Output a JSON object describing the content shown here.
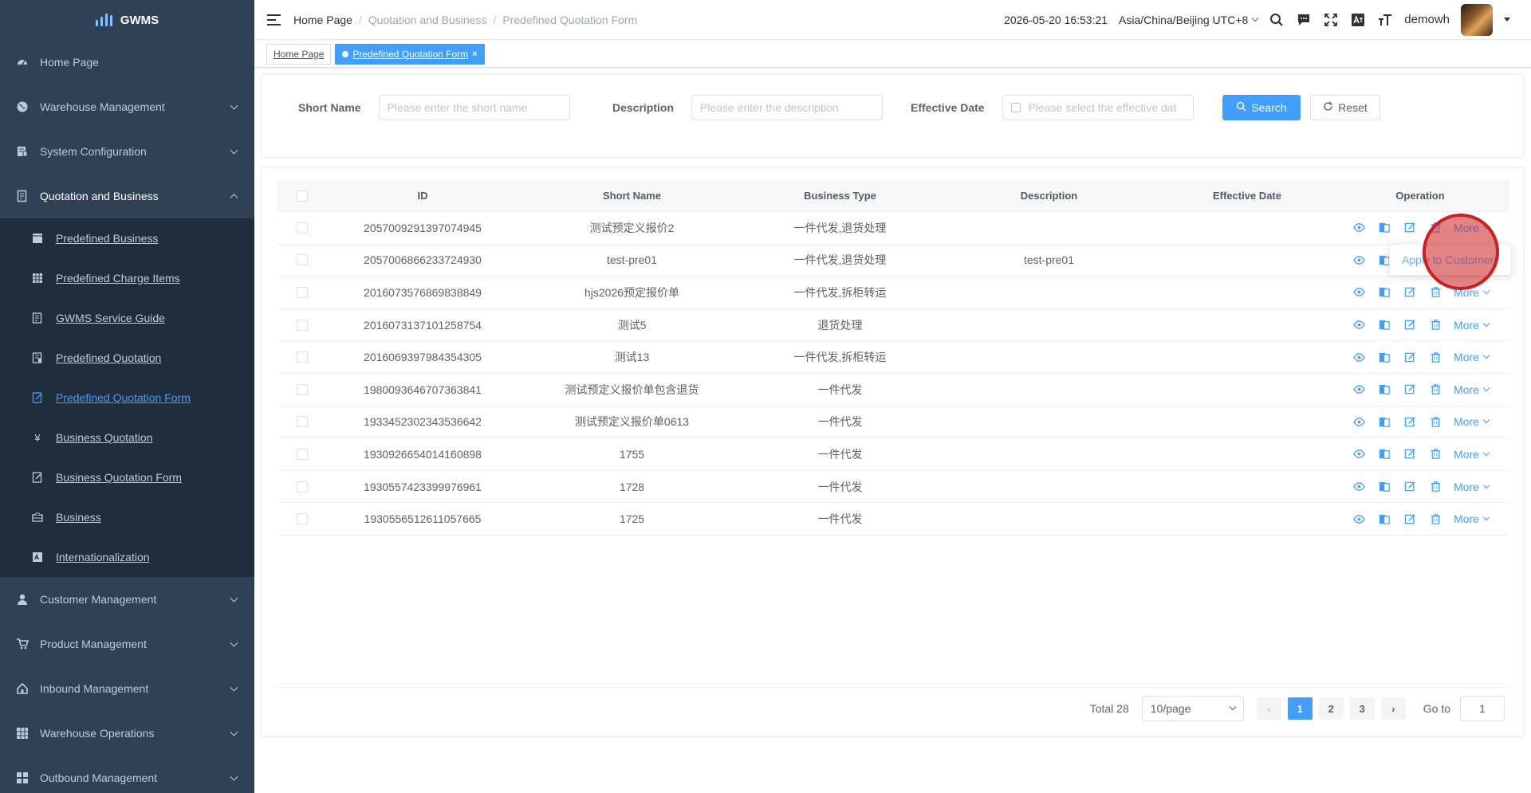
{
  "app": {
    "logo_text": "GWMS"
  },
  "sidebar": {
    "items": [
      {
        "label": "Home Page",
        "icon": "dashboard-icon"
      },
      {
        "label": "Warehouse Management",
        "icon": "globe-icon"
      },
      {
        "label": "System Configuration",
        "icon": "config-icon"
      },
      {
        "label": "Quotation and Business",
        "icon": "document-icon",
        "open": true
      }
    ],
    "subitems": [
      {
        "label": "Predefined Business",
        "icon": "folder-icon"
      },
      {
        "label": "Predefined Charge Items",
        "icon": "table-icon"
      },
      {
        "label": "GWMS Service Guide",
        "icon": "guide-icon"
      },
      {
        "label": "Predefined Quotation",
        "icon": "quotation-icon"
      },
      {
        "label": "Predefined Quotation Form",
        "icon": "form-icon",
        "active": true
      },
      {
        "label": "Business Quotation",
        "icon": "yen-icon"
      },
      {
        "label": "Business Quotation Form",
        "icon": "edit-form-icon"
      },
      {
        "label": "Business",
        "icon": "briefcase-icon"
      },
      {
        "label": "Internationalization",
        "icon": "language-icon"
      }
    ],
    "lower_items": [
      {
        "label": "Customer Management",
        "icon": "user-icon"
      },
      {
        "label": "Product Management",
        "icon": "cart-icon"
      },
      {
        "label": "Inbound Management",
        "icon": "home-icon"
      },
      {
        "label": "Warehouse Operations",
        "icon": "grid-icon"
      },
      {
        "label": "Outbound Management",
        "icon": "apps-icon"
      }
    ]
  },
  "header": {
    "breadcrumb": [
      "Home Page",
      "Quotation and Business",
      "Predefined Quotation Form"
    ],
    "datetime": "2026-05-20 16:53:21",
    "timezone": "Asia/China/Beijing UTC+8",
    "username": "demowh"
  },
  "tags": [
    {
      "label": "Home Page",
      "active": false
    },
    {
      "label": "Predefined Quotation Form",
      "active": true
    }
  ],
  "search": {
    "short_name_label": "Short Name",
    "short_name_placeholder": "Please enter the short name",
    "description_label": "Description",
    "description_placeholder": "Please enter the description",
    "effective_date_label": "Effective Date",
    "effective_date_placeholder": "Please select the effective dat",
    "search_button": "Search",
    "reset_button": "Reset"
  },
  "table": {
    "columns": [
      "ID",
      "Short Name",
      "Business Type",
      "Description",
      "Effective Date",
      "Operation"
    ],
    "more_label": "More",
    "rows": [
      {
        "id": "2057009291397074945",
        "short_name": "测试预定义报价2",
        "business_type": "一件代发,退货处理",
        "description": "",
        "effective_date": ""
      },
      {
        "id": "2057006866233724930",
        "short_name": "test-pre01",
        "business_type": "一件代发,退货处理",
        "description": "test-pre01",
        "effective_date": ""
      },
      {
        "id": "2016073576869838849",
        "short_name": "hjs2026预定报价单",
        "business_type": "一件代发,拆柜转运",
        "description": "",
        "effective_date": ""
      },
      {
        "id": "2016073137101258754",
        "short_name": "测试5",
        "business_type": "退货处理",
        "description": "",
        "effective_date": ""
      },
      {
        "id": "2016069397984354305",
        "short_name": "测试13",
        "business_type": "一件代发,拆柜转运",
        "description": "",
        "effective_date": ""
      },
      {
        "id": "1980093646707363841",
        "short_name": "测试预定义报价单包含退货",
        "business_type": "一件代发",
        "description": "",
        "effective_date": ""
      },
      {
        "id": "1933452302343536642",
        "short_name": "测试预定义报价单0613",
        "business_type": "一件代发",
        "description": "",
        "effective_date": ""
      },
      {
        "id": "1930926654014160898",
        "short_name": "1755",
        "business_type": "一件代发",
        "description": "",
        "effective_date": ""
      },
      {
        "id": "1930557423399976961",
        "short_name": "1728",
        "business_type": "一件代发",
        "description": "",
        "effective_date": ""
      },
      {
        "id": "1930556512611057665",
        "short_name": "1725",
        "business_type": "一件代发",
        "description": "",
        "effective_date": ""
      }
    ]
  },
  "dropdown": {
    "item": "Apply to Customer"
  },
  "pagination": {
    "total": "Total 28",
    "page_size": "10/page",
    "pages": [
      "1",
      "2",
      "3"
    ],
    "current": "1",
    "goto_label": "Go to",
    "goto_value": "1"
  },
  "colors": {
    "sidebar_bg": "#304156",
    "submenu_bg": "#1f2d3d",
    "accent": "#409eff"
  }
}
